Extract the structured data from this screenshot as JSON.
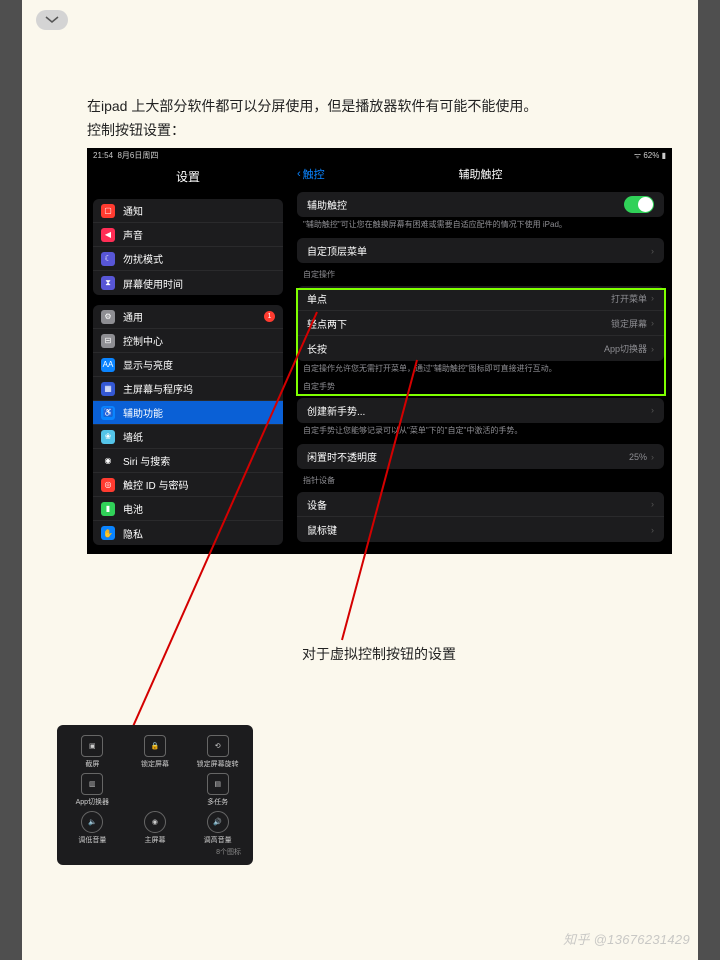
{
  "article": {
    "paragraph_line1": "在ipad 上大部分软件都可以分屏使用，但是播放器软件有可能不能使用。",
    "paragraph_line2": "控制按钮设置：",
    "caption": "对于虚拟控制按钮的设置",
    "watermark": "知乎 @13676231429"
  },
  "status": {
    "time": "21:54",
    "date": "8月6日周四",
    "battery": "62%"
  },
  "sidebar": {
    "title": "设置",
    "groups": [
      [
        {
          "icon_bg": "#ff3b30",
          "label": "通知",
          "name": "notifications"
        },
        {
          "icon_bg": "#ff2d55",
          "label": "声音",
          "name": "sounds"
        },
        {
          "icon_bg": "#5856d6",
          "label": "勿扰模式",
          "name": "dnd"
        },
        {
          "icon_bg": "#5856d6",
          "label": "屏幕使用时间",
          "name": "screentime"
        }
      ],
      [
        {
          "icon_bg": "#8e8e93",
          "label": "通用",
          "name": "general",
          "badge": "1"
        },
        {
          "icon_bg": "#8e8e93",
          "label": "控制中心",
          "name": "control-center"
        },
        {
          "icon_bg": "#0a84ff",
          "label": "显示与亮度",
          "name": "display"
        },
        {
          "icon_bg": "#3458d4",
          "label": "主屏幕与程序坞",
          "name": "home"
        },
        {
          "icon_bg": "#0a84ff",
          "label": "辅助功能",
          "name": "accessibility",
          "selected": true
        },
        {
          "icon_bg": "#54c4e8",
          "label": "墙纸",
          "name": "wallpaper"
        },
        {
          "icon_bg": "#1c1c1e",
          "label": "Siri 与搜索",
          "name": "siri"
        },
        {
          "icon_bg": "#ff3b30",
          "label": "触控 ID 与密码",
          "name": "touchid"
        },
        {
          "icon_bg": "#30d158",
          "label": "电池",
          "name": "battery"
        },
        {
          "icon_bg": "#0a84ff",
          "label": "隐私",
          "name": "privacy"
        }
      ]
    ]
  },
  "detail": {
    "back": "触控",
    "title": "辅助触控",
    "main_switch": {
      "label": "辅助触控"
    },
    "main_footer": "\"辅助触控\"可让您在触摸屏幕有困难或需要自适应配件的情况下使用 iPad。",
    "top_menu": {
      "label": "自定顶层菜单"
    },
    "custom_header": "自定操作",
    "custom_rows": [
      {
        "label": "单点",
        "value": "打开菜单"
      },
      {
        "label": "轻点两下",
        "value": "锁定屏幕"
      },
      {
        "label": "长按",
        "value": "App切换器"
      }
    ],
    "custom_footer": "自定操作允许您无需打开菜单，通过\"辅助触控\"图标即可直接进行互动。",
    "gesture_header": "自定手势",
    "gesture_row": {
      "label": "创建新手势..."
    },
    "gesture_footer": "自定手势让您能够记录可以从\"菜单\"下的\"自定\"中激活的手势。",
    "idle_row": {
      "label": "闲置时不透明度",
      "value": "25%"
    },
    "pointer_header": "指针设备",
    "device_row": {
      "label": "设备"
    },
    "mouse_row": {
      "label": "鼠标键"
    }
  },
  "panel": {
    "items": [
      {
        "label": "截屏",
        "icon": "screenshot"
      },
      {
        "label": "锁定屏幕",
        "icon": "lock"
      },
      {
        "label": "锁定屏幕旋转",
        "icon": "rotation-lock"
      },
      {
        "label": "App切换器",
        "icon": "app-switcher"
      },
      {
        "label": "多任务",
        "icon": "multitask"
      },
      {
        "label": "调低音量",
        "icon": "vol-down"
      },
      {
        "label": "主屏幕",
        "icon": "home"
      },
      {
        "label": "调高音量",
        "icon": "vol-up"
      }
    ],
    "count": "8个图标"
  }
}
